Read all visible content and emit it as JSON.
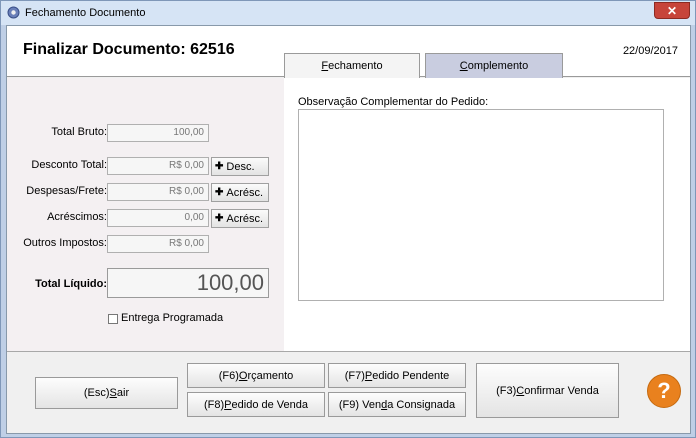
{
  "window": {
    "title": "Fechamento Documento",
    "close_label": "✕"
  },
  "header": {
    "title": "Finalizar Documento: 62516",
    "date": "22/09/2017"
  },
  "tabs": [
    {
      "label": "Fechamento",
      "accel": "F",
      "rest": "echamento"
    },
    {
      "label": "Complemento",
      "accel": "C",
      "rest": "omplemento"
    }
  ],
  "fields": {
    "total_bruto": {
      "label": "Total Bruto:",
      "value": "100,00"
    },
    "desconto_total": {
      "label": "Desconto Total:",
      "value": "R$ 0,00",
      "button": "Desc."
    },
    "despesas_frete": {
      "label": "Despesas/Frete:",
      "value": "R$ 0,00",
      "button": "Acrésc."
    },
    "acrescimos": {
      "label": "Acréscimos:",
      "value": "0,00",
      "button": "Acrésc."
    },
    "outros_impostos": {
      "label": "Outros Impostos:",
      "value": "R$ 0,00"
    },
    "total_liquido": {
      "label": "Total Líquido:",
      "value": "100,00"
    }
  },
  "entrega": {
    "label": "Entrega Programada",
    "checked": false
  },
  "observacao": {
    "label": "Observação Complementar do Pedido:",
    "value": ""
  },
  "buttons": {
    "sair": {
      "pre": "(Esc) ",
      "accel": "S",
      "rest": "air"
    },
    "orcamento": {
      "pre": "(F6) ",
      "accel": "O",
      "rest": "rçamento"
    },
    "pedido_pendente": {
      "pre": "(F7) ",
      "accel": "P",
      "rest": "edido Pendente"
    },
    "pedido_venda": {
      "pre": "(F8) ",
      "accel": "P",
      "rest": "edido de Venda"
    },
    "venda_consignada": {
      "pre": "(F9) Ven",
      "accel": "d",
      "rest": "a Consignada"
    },
    "confirmar": {
      "pre": "(F3) ",
      "accel": "C",
      "rest": "onfirmar Venda"
    },
    "help": "?"
  },
  "colors": {
    "help_accent": "#e9811e",
    "tab_active": "#c9cde0"
  }
}
